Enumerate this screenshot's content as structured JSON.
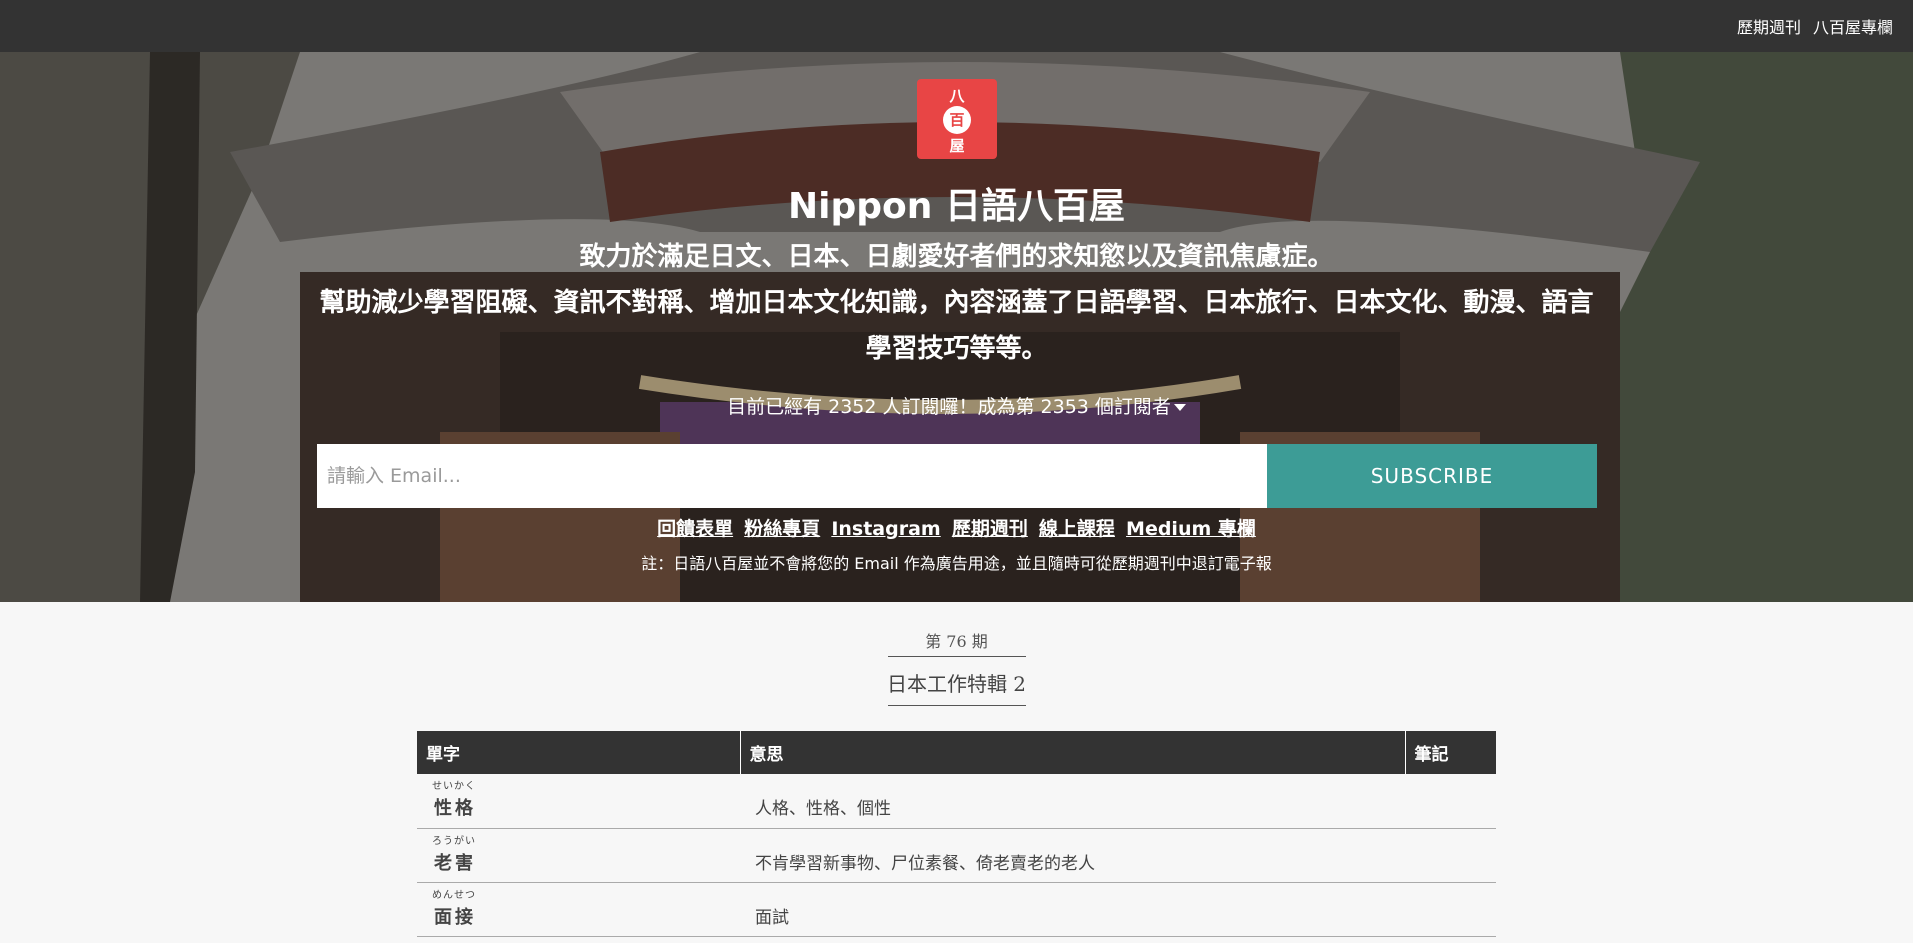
{
  "nav": {
    "items": [
      "歷期週刊",
      "八百屋專欄"
    ]
  },
  "hero": {
    "logo_chars": [
      "八",
      "百",
      "屋"
    ],
    "title": "Nippon 日語八百屋",
    "lead_line1": "致力於滿足日文、日本、日劇愛好者們的求知慾以及資訊焦慮症。",
    "lead_line2": "幫助減少學習阻礙、資訊不對稱、增加日本文化知識，內容涵蓋了日語學習、日本旅行、日本文化、動漫、語言學習技巧等等。",
    "subscriber_text": "目前已經有 2352 人訂閱囉！成為第 2353 個訂閱者",
    "email_placeholder": "請輸入 Email...",
    "subscribe_label": "SUBSCRIBE",
    "links": [
      "回饋表單",
      "粉絲專頁",
      "Instagram",
      "歷期週刊",
      "線上課程",
      "Medium 專欄"
    ],
    "note": "註：日語八百屋並不會將您的 Email 作為廣告用途，並且隨時可從歷期週刊中退訂電子報"
  },
  "issue": {
    "number_label": "第 76 期",
    "title": "日本工作特輯 2"
  },
  "table": {
    "headers": [
      "單字",
      "意思",
      "筆記"
    ],
    "rows": [
      {
        "reading": "せいかく",
        "word": "性格",
        "meaning": "人格、性格、個性",
        "note": ""
      },
      {
        "reading": "ろうがい",
        "word": "老害",
        "meaning": "不肯學習新事物、尸位素餐、倚老賣老的老人",
        "note": ""
      },
      {
        "reading": "めんせつ",
        "word": "面接",
        "meaning": "面試",
        "note": ""
      }
    ]
  },
  "colors": {
    "topbar": "#333333",
    "logo": "#e84545",
    "subscribe": "#3d9c96",
    "table_header": "#333333"
  }
}
